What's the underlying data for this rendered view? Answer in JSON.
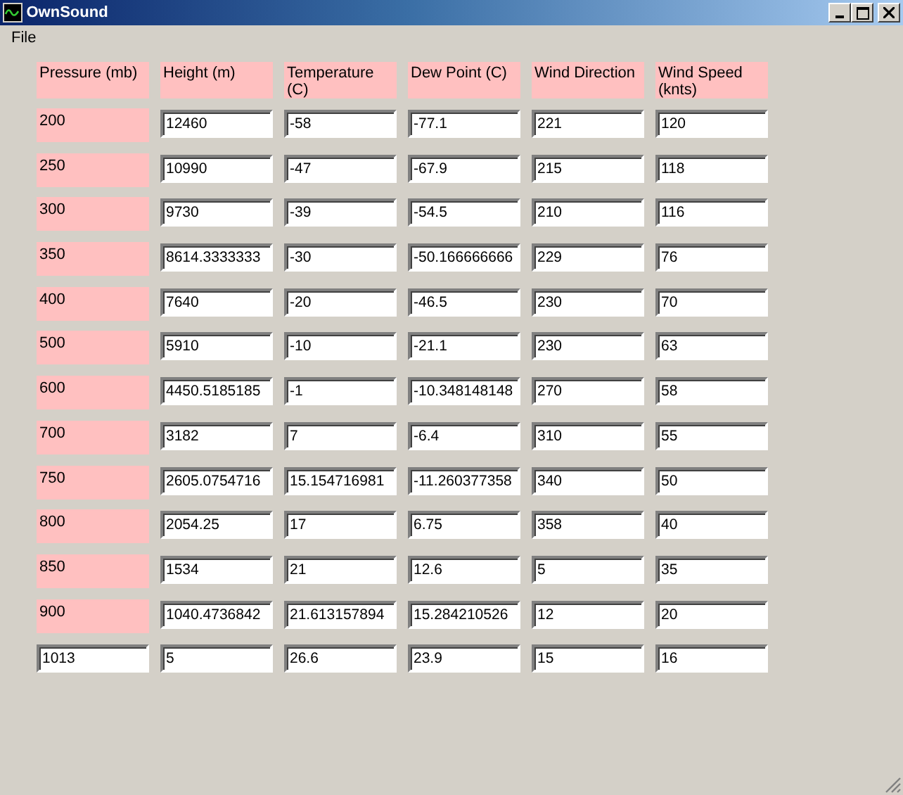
{
  "window": {
    "title": "OwnSound"
  },
  "menu": [
    "File"
  ],
  "columns": [
    "Pressure (mb)",
    "Height (m)",
    "Temperature (C)",
    "Dew Point (C)",
    "Wind Direction",
    "Wind Speed (knts)"
  ],
  "rows": [
    {
      "kind": "label",
      "cells": [
        "200",
        "12460",
        "-58",
        "-77.1",
        "221",
        "120"
      ]
    },
    {
      "kind": "label",
      "cells": [
        "250",
        "10990",
        "-47",
        "-67.9",
        "215",
        "118"
      ]
    },
    {
      "kind": "label",
      "cells": [
        "300",
        "9730",
        "-39",
        "-54.5",
        "210",
        "116"
      ]
    },
    {
      "kind": "label",
      "cells": [
        "350",
        "8614.3333333",
        "-30",
        "-50.166666666",
        "229",
        "76"
      ]
    },
    {
      "kind": "label",
      "cells": [
        "400",
        "7640",
        "-20",
        "-46.5",
        "230",
        "70"
      ]
    },
    {
      "kind": "label",
      "cells": [
        "500",
        "5910",
        "-10",
        "-21.1",
        "230",
        "63"
      ]
    },
    {
      "kind": "label",
      "cells": [
        "600",
        "4450.5185185",
        "-1",
        "-10.348148148",
        "270",
        "58"
      ]
    },
    {
      "kind": "label",
      "cells": [
        "700",
        "3182",
        "7",
        "-6.4",
        "310",
        "55"
      ]
    },
    {
      "kind": "label",
      "cells": [
        "750",
        "2605.0754716",
        "15.154716981",
        "-11.260377358",
        "340",
        "50"
      ]
    },
    {
      "kind": "label",
      "cells": [
        "800",
        "2054.25",
        "17",
        "6.75",
        "358",
        "40"
      ]
    },
    {
      "kind": "label",
      "cells": [
        "850",
        "1534",
        "21",
        "12.6",
        "5",
        "35"
      ]
    },
    {
      "kind": "label",
      "cells": [
        "900",
        "1040.4736842",
        "21.613157894",
        "15.284210526",
        "12",
        "20"
      ]
    },
    {
      "kind": "field",
      "cells": [
        "1013",
        "5",
        "26.6",
        "23.9",
        "15",
        "16"
      ]
    }
  ]
}
